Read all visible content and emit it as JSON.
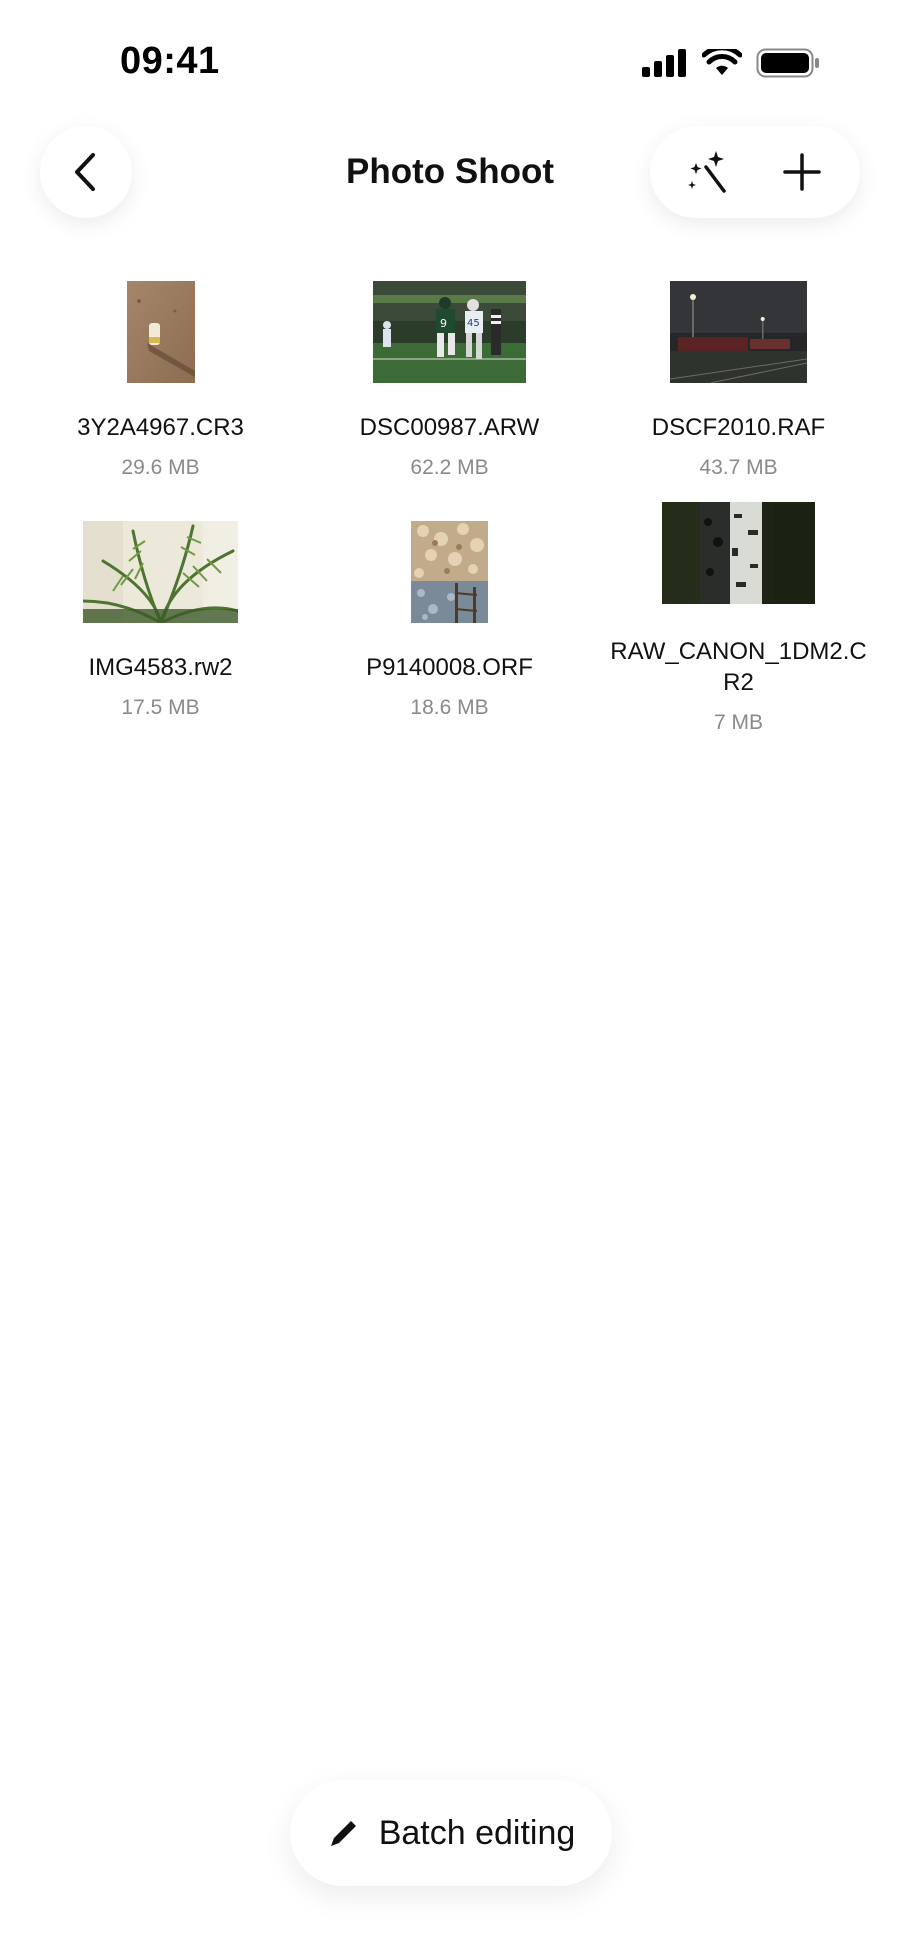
{
  "status_bar": {
    "time": "09:41",
    "icons": [
      "cellular-signal-icon",
      "wifi-icon",
      "battery-icon"
    ]
  },
  "header": {
    "title": "Photo Shoot",
    "back_icon": "chevron-left-icon",
    "actions": [
      "magic-wand-icon",
      "plus-icon"
    ]
  },
  "files": [
    {
      "name": "3Y2A4967.CR3",
      "size": "29.6 MB",
      "thumbnail": "sand-beach-photo"
    },
    {
      "name": "DSC00987.ARW",
      "size": "62.2 MB",
      "thumbnail": "football-game-photo"
    },
    {
      "name": "DSCF2010.RAF",
      "size": "43.7 MB",
      "thumbnail": "night-railyard-photo"
    },
    {
      "name": "IMG4583.rw2",
      "size": "17.5 MB",
      "thumbnail": "palm-leaves-photo"
    },
    {
      "name": "P9140008.ORF",
      "size": "18.6 MB",
      "thumbnail": "dry-grass-fence-photo"
    },
    {
      "name": "RAW_CANON_1DM2.CR2",
      "size": "7 MB",
      "thumbnail": "birch-trunk-photo"
    }
  ],
  "footer": {
    "batch_label": "Batch editing",
    "batch_icon": "pencil-icon"
  },
  "colors": {
    "background": "#ffffff",
    "text_primary": "#111111",
    "text_secondary": "#8a8a8a"
  }
}
